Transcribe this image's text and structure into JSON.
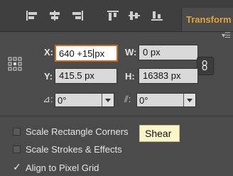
{
  "toolbar": {
    "icons": [
      "align-left-icon",
      "align-center-icon",
      "align-right-icon",
      "align-top-icon",
      "align-middle-icon",
      "align-bottom-icon"
    ],
    "tab_label": "Transform"
  },
  "panel_menu_icon": "panel-menu-icon",
  "transform": {
    "x_label": "X:",
    "x_value_before_caret": "640 +15",
    "x_value_after_caret": "px",
    "w_label": "W:",
    "w_value": "0 px",
    "y_label": "Y:",
    "y_value": "415.5 px",
    "h_label": "H:",
    "h_value": "16383 px",
    "rotate_value": "0°",
    "shear_value": "0°",
    "link_icon": "constrain-proportions-icon",
    "rotate_icon": "rotate-angle-icon",
    "shear_icon": "shear-angle-icon"
  },
  "options": [
    {
      "label": "Scale Rectangle Corners",
      "checked": false
    },
    {
      "label": "Scale Strokes & Effects",
      "checked": false
    },
    {
      "label": "Align to Pixel Grid",
      "checked": true
    }
  ],
  "tooltip": "Shear",
  "colors": {
    "panel_bg": "#4b4b4b",
    "accent": "#e6a23c",
    "active_border": "#c76b2a",
    "tooltip_bg": "#fbf6c9"
  }
}
